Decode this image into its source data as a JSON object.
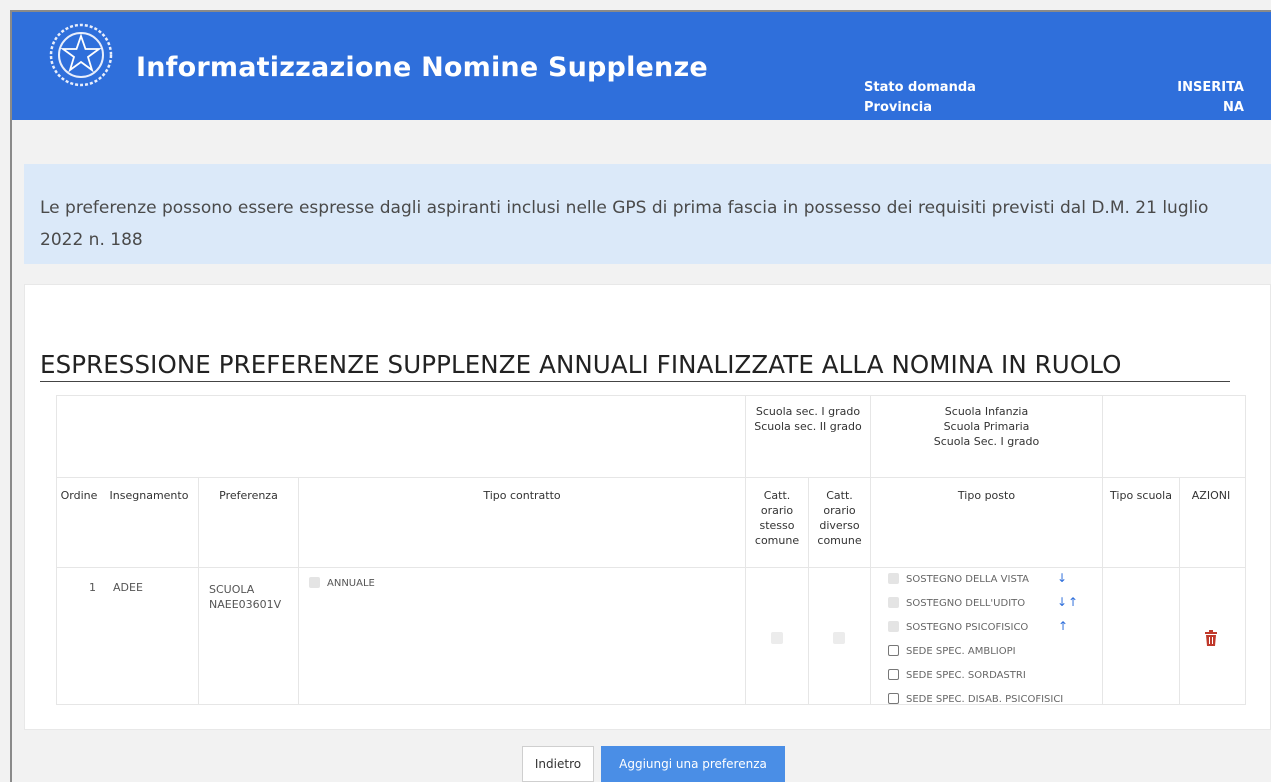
{
  "header": {
    "app_title": "Informatizzazione Nomine Supplenze",
    "status_label": "Stato domanda",
    "status_value": "INSERITA",
    "province_label": "Provincia",
    "province_value": "NA",
    "emblem_icon": "italian-republic-emblem",
    "bg_color": "#2f6fdb"
  },
  "notice": {
    "text": "Le preferenze possono essere espresse dagli aspiranti inclusi nelle GPS di prima fascia in possesso dei requisiti previsti dal D.M. 21 luglio 2022 n. 188"
  },
  "section": {
    "title": "ESPRESSIONE PREFERENZE SUPPLENZE ANNUALI FINALIZZATE ALLA NOMINA IN RUOLO"
  },
  "table": {
    "group_headers": {
      "secondary_1": "Scuola sec. I grado",
      "secondary_2": "Scuola sec. II grado",
      "infanzia": "Scuola Infanzia",
      "primaria": "Scuola Primaria",
      "sec_1": "Scuola Sec. I grado"
    },
    "columns": {
      "ordine": "Ordine",
      "insegnamento": "Insegnamento",
      "preferenza": "Preferenza",
      "tipo_contratto": "Tipo contratto",
      "catt_stesso_1": "Catt.",
      "catt_stesso_2": "orario",
      "catt_stesso_3": "stesso",
      "catt_stesso_4": "comune",
      "catt_diverso_1": "Catt.",
      "catt_diverso_2": "orario",
      "catt_diverso_3": "diverso",
      "catt_diverso_4": "comune",
      "tipo_posto": "Tipo posto",
      "tipo_scuola": "Tipo scuola",
      "azioni": "AZIONI"
    },
    "rows": [
      {
        "ordine": "1",
        "insegnamento": "ADEE",
        "preferenza_1": "SCUOLA",
        "preferenza_2": "NAEE03601V",
        "tipo_contratto": "ANNUALE",
        "tipo_posto": [
          {
            "label": "SOSTEGNO DELLA VISTA",
            "enabled": false,
            "arrows": "down"
          },
          {
            "label": "SOSTEGNO DELL'UDITO",
            "enabled": false,
            "arrows": "down-up"
          },
          {
            "label": "SOSTEGNO PSICOFISICO",
            "enabled": false,
            "arrows": "up"
          },
          {
            "label": "SEDE SPEC. AMBLIOPI",
            "enabled": true
          },
          {
            "label": "SEDE SPEC. SORDASTRI",
            "enabled": true
          },
          {
            "label": "SEDE SPEC. DISAB. PSICOFISICI",
            "enabled": true
          }
        ],
        "action_icon": "trash-icon",
        "action_color": "#c0392b"
      }
    ]
  },
  "buttons": {
    "back": "Indietro",
    "add": "Aggiungi una preferenza"
  },
  "arrow_glyphs": {
    "down": "↓",
    "up": "↑"
  }
}
